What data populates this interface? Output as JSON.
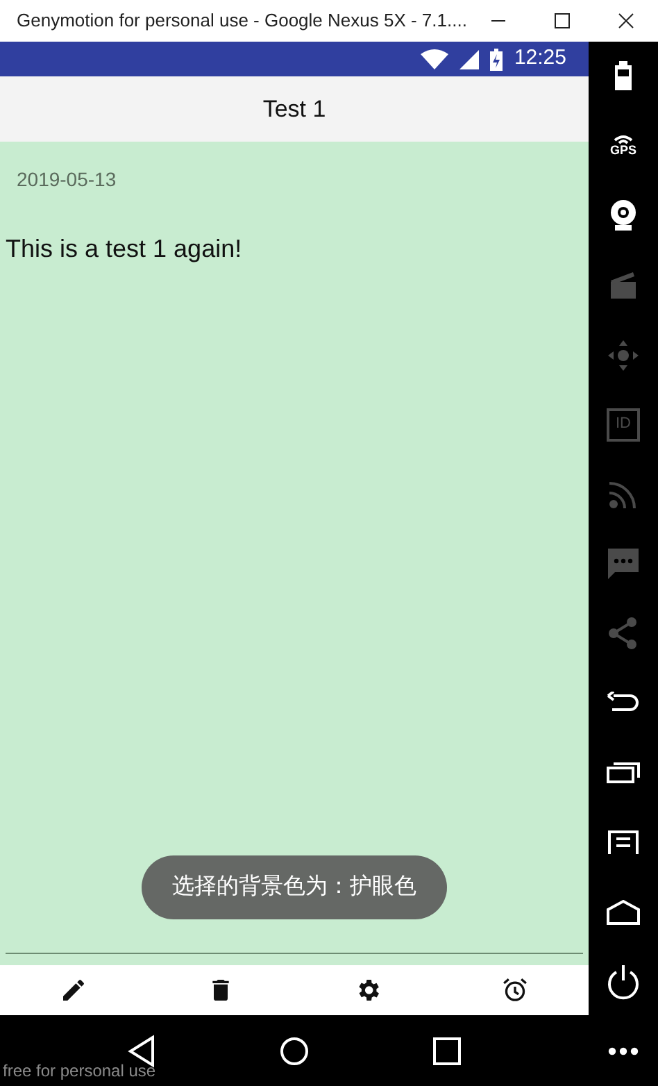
{
  "window": {
    "title": "Genymotion for personal use - Google Nexus 5X - 7.1...."
  },
  "status_bar": {
    "time": "12:25"
  },
  "toolbar": {
    "title": "Test 1"
  },
  "note": {
    "date": "2019-05-13",
    "text": "This is a test 1 again!"
  },
  "toast": {
    "text": "选择的背景色为：护眼色"
  },
  "bottom_actions": [
    {
      "kind": "edit"
    },
    {
      "kind": "delete"
    },
    {
      "kind": "settings"
    },
    {
      "kind": "alarm"
    }
  ],
  "side_tools": [
    {
      "kind": "battery",
      "disabled": false
    },
    {
      "kind": "gps",
      "label": "GPS",
      "disabled": false
    },
    {
      "kind": "webcam",
      "disabled": false
    },
    {
      "kind": "capture",
      "disabled": true
    },
    {
      "kind": "dpad",
      "disabled": true
    },
    {
      "kind": "id",
      "label": "ID",
      "disabled": true
    },
    {
      "kind": "rss",
      "disabled": true
    },
    {
      "kind": "message",
      "disabled": true
    },
    {
      "kind": "share",
      "disabled": true
    },
    {
      "kind": "back",
      "disabled": false
    },
    {
      "kind": "recent",
      "disabled": false
    },
    {
      "kind": "menu",
      "disabled": false
    },
    {
      "kind": "home",
      "disabled": false
    },
    {
      "kind": "power",
      "disabled": false
    },
    {
      "kind": "more",
      "disabled": false
    }
  ],
  "nav_bar": [
    {
      "kind": "back"
    },
    {
      "kind": "home"
    },
    {
      "kind": "recent"
    }
  ],
  "overlay_note": "free for personal use"
}
